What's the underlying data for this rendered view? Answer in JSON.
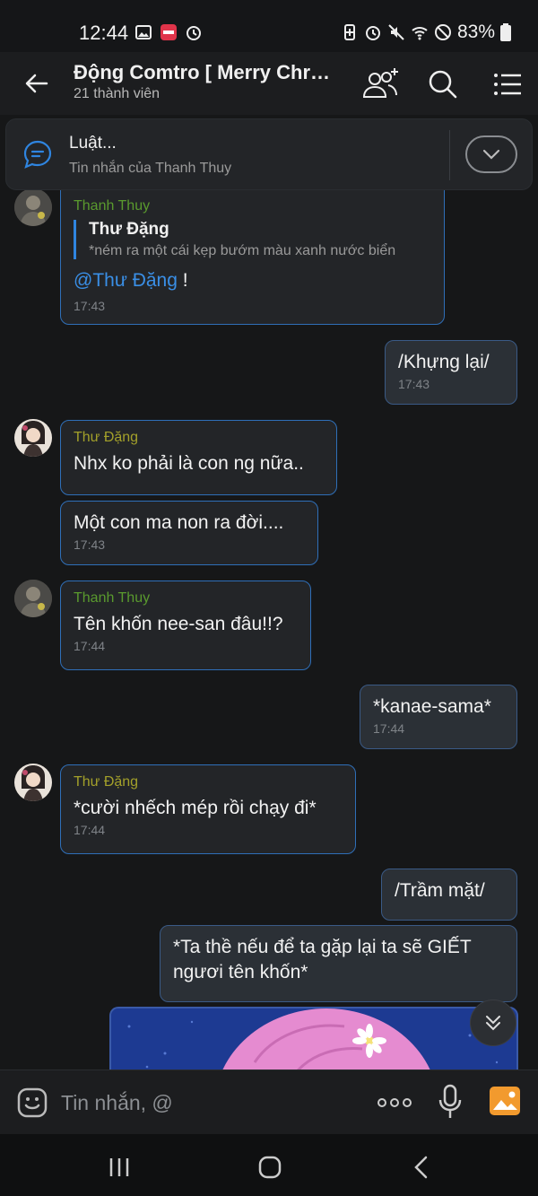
{
  "status_bar": {
    "time": "12:44",
    "battery": "83%",
    "left_icons": [
      "image-icon",
      "manga-toon-icon",
      "alarm-icon"
    ],
    "right_icons": [
      "battery-saver-icon",
      "alarm-icon",
      "mute-icon",
      "wifi-icon",
      "do-not-disturb-icon",
      "battery-icon"
    ]
  },
  "header": {
    "title": "Động Comtro [ Merry Christmas ]",
    "subtitle": "21 thành viên",
    "icons": [
      "back-arrow-icon",
      "add-member-icon",
      "search-icon",
      "menu-icon"
    ]
  },
  "pinned": {
    "title": "Luật...",
    "subtitle": "Tin nhắn của Thanh Thuy"
  },
  "messages": [
    {
      "sender": "Thanh Thuy",
      "quote_name": "Thư Đặng",
      "quote_text": "*ném ra một cái kẹp bướm màu xanh nước biển",
      "mention": "@Thư Đặng",
      "text": " !",
      "time": "17:43"
    },
    {
      "text": "/Khựng lại/",
      "time": "17:43"
    },
    {
      "sender": "Thư Đặng",
      "text": "Nhx ko phải là con ng nữa..",
      "time": ""
    },
    {
      "text": "Một con ma non ra đời....",
      "time": "17:43"
    },
    {
      "sender": "Thanh Thuy",
      "text": "Tên khốn nee-san đâu!!?",
      "time": "17:44"
    },
    {
      "text": "*kanae-sama*",
      "time": "17:44"
    },
    {
      "sender": "Thư Đặng",
      "text": "*cười nhếch mép rồi chạy đi*",
      "time": "17:44"
    },
    {
      "text": "/Trầm mặt/",
      "time": ""
    },
    {
      "text": "*Ta thề nếu để ta gặp lại ta sẽ GIẾT ngươi tên khốn*",
      "time": ""
    }
  ],
  "composer": {
    "placeholder": "Tin nhắn, @",
    "icons": [
      "emoji-icon",
      "more-icon",
      "microphone-icon",
      "photo-icon"
    ]
  },
  "colors": {
    "accent_blue": "#2f85e0",
    "sender_green": "#5a9a2e",
    "sender_olive": "#a3a02a",
    "background": "#161718"
  }
}
